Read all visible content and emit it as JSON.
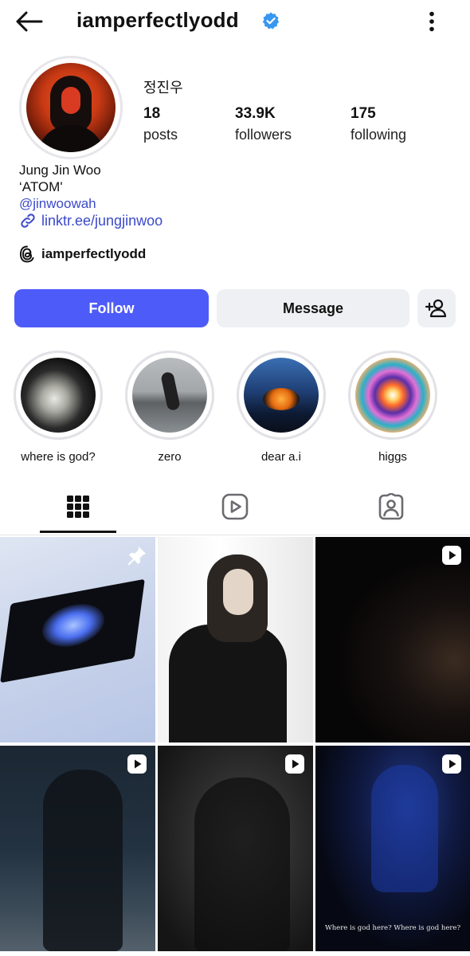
{
  "header": {
    "username": "iamperfectlyodd"
  },
  "profile": {
    "display_name": "정진우",
    "stats": [
      {
        "value": "18",
        "label": "posts"
      },
      {
        "value": "33.9K",
        "label": "followers"
      },
      {
        "value": "175",
        "label": "following"
      }
    ],
    "bio": {
      "name": "Jung Jin Woo",
      "line2": "‘ATOM'",
      "mention": "@jinwoowah",
      "link": "linktr.ee/jungjinwoo",
      "threads_handle": "iamperfectlyodd"
    }
  },
  "actions": {
    "follow_label": "Follow",
    "message_label": "Message"
  },
  "highlights": [
    {
      "label": "where is god?"
    },
    {
      "label": "zero"
    },
    {
      "label": "dear a.i"
    },
    {
      "label": "higgs"
    }
  ],
  "tabs": [
    {
      "icon": "grid-icon",
      "selected": true
    },
    {
      "icon": "reels-icon",
      "selected": false
    },
    {
      "icon": "tagged-icon",
      "selected": false
    }
  ],
  "posts": [
    {
      "badge": "pin-icon"
    },
    {
      "badge": ""
    },
    {
      "badge": "reel-icon"
    },
    {
      "badge": "reel-icon"
    },
    {
      "badge": "reel-icon"
    },
    {
      "badge": "reel-icon",
      "caption": "Where is god here? Where is god here?"
    }
  ],
  "colors": {
    "follow_button": "#4d5bf9",
    "link": "#3b49c9",
    "verified": "#3897f0",
    "secondary_button": "#eff0f3"
  }
}
